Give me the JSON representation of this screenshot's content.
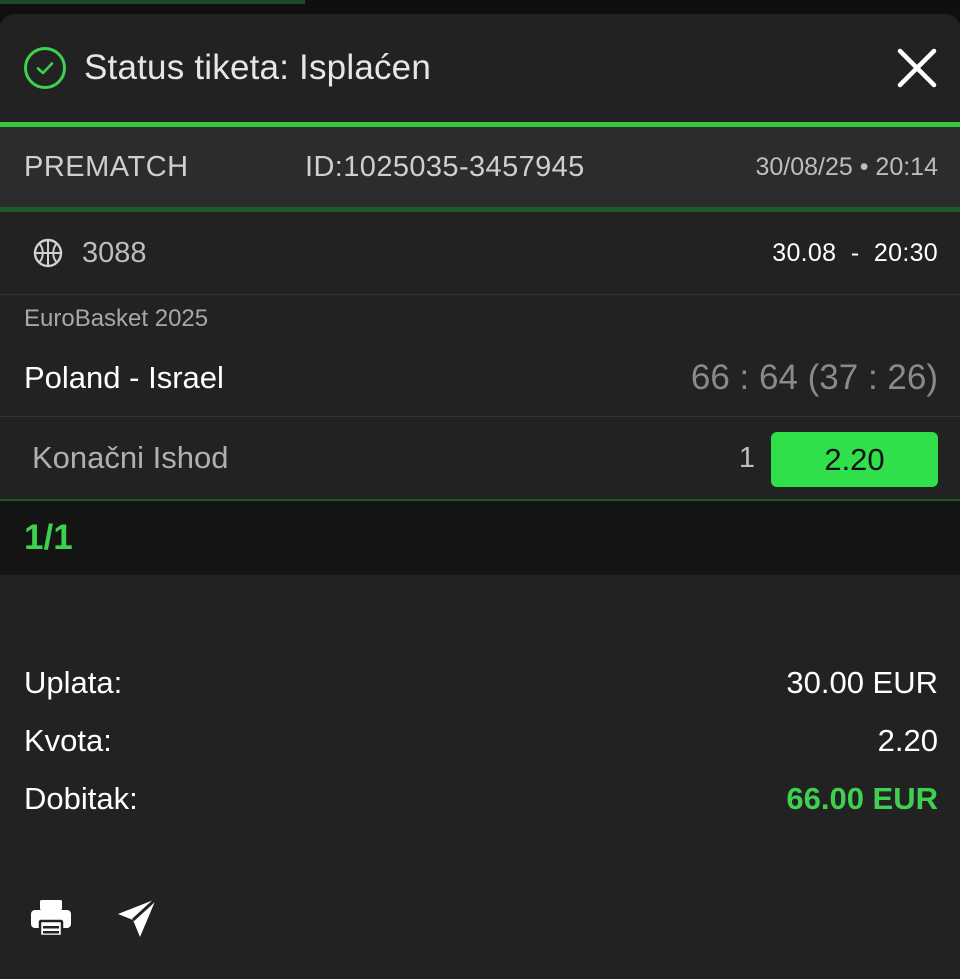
{
  "header": {
    "status_text": "Status tiketa: Isplaćen",
    "status_icon": "check-circle-icon",
    "close_icon": "close-icon"
  },
  "ticket_meta": {
    "type": "PREMATCH",
    "id": "ID:1025035-3457945",
    "datetime": "30/08/25 • 20:14"
  },
  "event": {
    "sport_icon": "basketball-icon",
    "code": "3088",
    "start": "30.08  -  20:30",
    "league": "EuroBasket 2025",
    "match": "Poland - Israel",
    "score": "66 : 64 (37 : 26)",
    "market": "Konačni Ishod",
    "pick": "1",
    "odd": "2.20"
  },
  "count": "1/1",
  "summary": {
    "stake_label": "Uplata:",
    "stake_value": "30.00 EUR",
    "odds_label": "Kvota:",
    "odds_value": "2.20",
    "win_label": "Dobitak:",
    "win_value": "66.00 EUR"
  },
  "actions": {
    "print_icon": "print-icon",
    "share_icon": "send-icon"
  },
  "colors": {
    "accent": "#34c93f",
    "badge": "#2fe04a",
    "panel": "#222222",
    "meta_bg": "#2c2c2c"
  }
}
